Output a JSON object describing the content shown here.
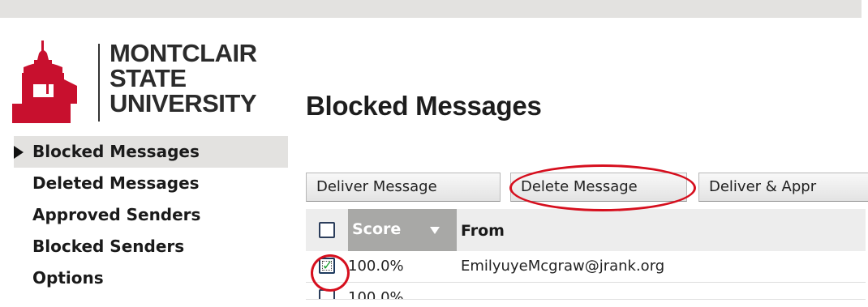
{
  "logo": {
    "line1": "MONTCLAIR",
    "line2": "STATE",
    "line3": "UNIVERSITY"
  },
  "page": {
    "title": "Blocked Messages"
  },
  "sidebar": {
    "items": [
      {
        "label": "Blocked Messages",
        "active": true
      },
      {
        "label": "Deleted Messages"
      },
      {
        "label": "Approved Senders"
      },
      {
        "label": "Blocked Senders"
      },
      {
        "label": "Options"
      }
    ]
  },
  "toolbar": {
    "deliver_label": "Deliver Message",
    "delete_label": "Delete Message",
    "approve_label": "Deliver & Appr"
  },
  "table": {
    "columns": {
      "score": "Score",
      "from": "From"
    },
    "rows": [
      {
        "checked": true,
        "score": "100.0%",
        "from": "EmilyuyeMcgraw@jrank.org"
      },
      {
        "checked": false,
        "score": "100.0%",
        "from": ""
      }
    ]
  },
  "colors": {
    "accent": "#d60f1e",
    "logo_red": "#c8102e",
    "header_active": "#a8a8a6"
  }
}
